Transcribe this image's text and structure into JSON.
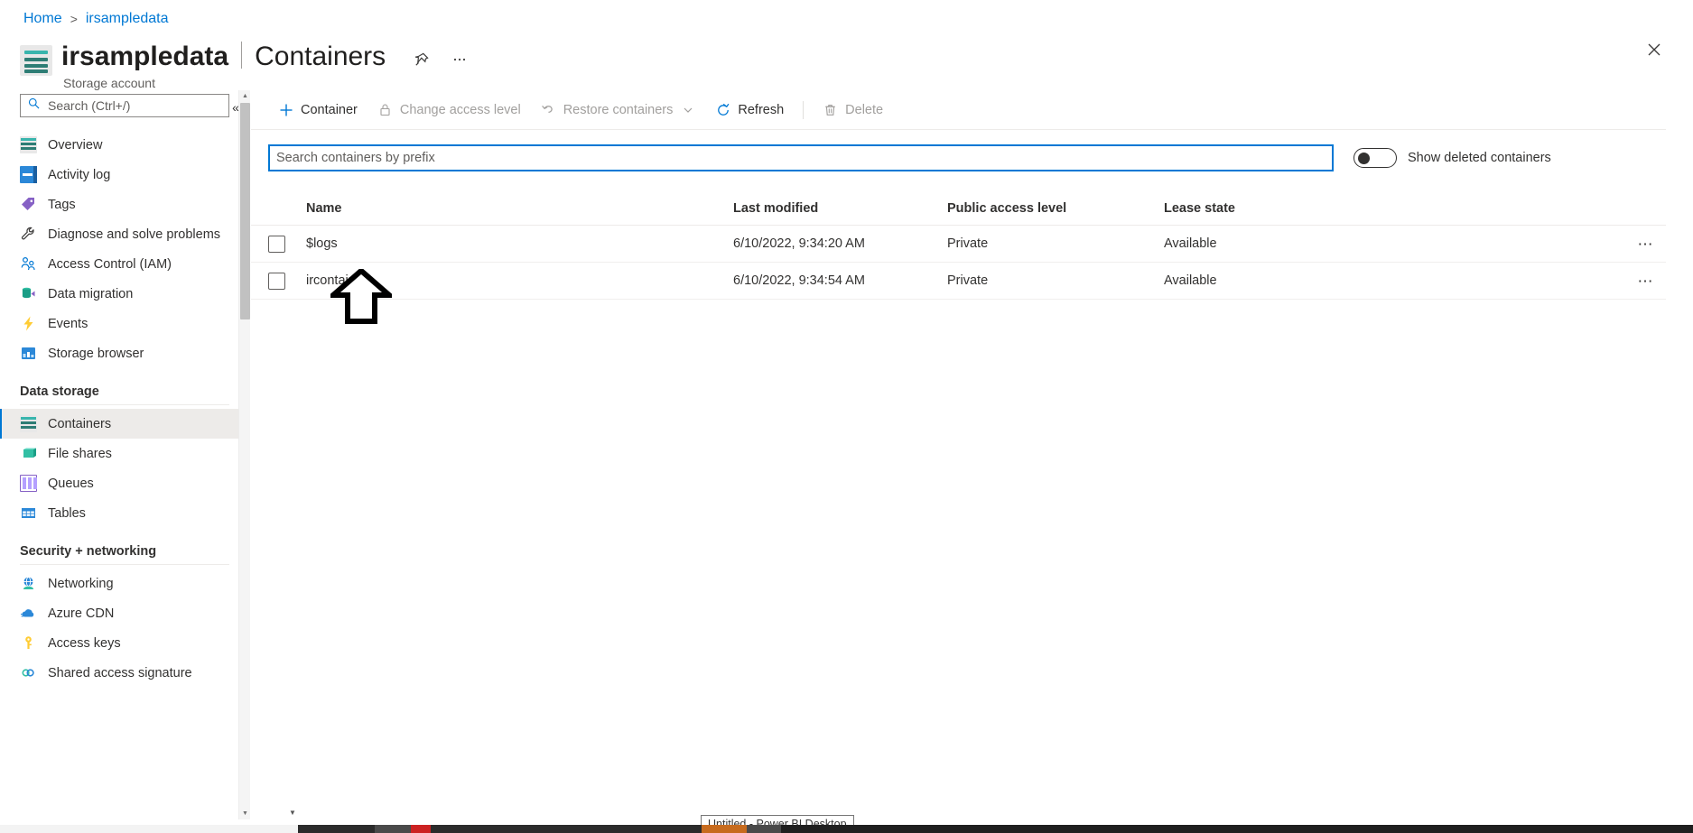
{
  "breadcrumb": {
    "home": "Home",
    "separator": ">",
    "current": "irsampledata"
  },
  "header": {
    "resource_name": "irsampledata",
    "divider": "|",
    "page_name": "Containers",
    "caption": "Storage account",
    "pin_icon": "pin-icon",
    "more_icon": "ellipsis-icon",
    "close_icon": "close-icon",
    "resource_icon": "storage-account-icon"
  },
  "sidebar": {
    "search": {
      "placeholder": "Search (Ctrl+/)",
      "value": "",
      "icon": "search-icon"
    },
    "collapse_icon": "chevron-double-left-icon",
    "items": [
      {
        "label": "Overview",
        "icon": "overview-icon",
        "selected": false
      },
      {
        "label": "Activity log",
        "icon": "activity-log-icon",
        "selected": false
      },
      {
        "label": "Tags",
        "icon": "tags-icon",
        "selected": false
      },
      {
        "label": "Diagnose and solve problems",
        "icon": "wrench-icon",
        "selected": false
      },
      {
        "label": "Access Control (IAM)",
        "icon": "people-icon",
        "selected": false
      },
      {
        "label": "Data migration",
        "icon": "data-migration-icon",
        "selected": false
      },
      {
        "label": "Events",
        "icon": "lightning-icon",
        "selected": false
      },
      {
        "label": "Storage browser",
        "icon": "storage-browser-icon",
        "selected": false
      }
    ],
    "groups": [
      {
        "title": "Data storage",
        "items": [
          {
            "label": "Containers",
            "icon": "containers-icon",
            "selected": true
          },
          {
            "label": "File shares",
            "icon": "file-shares-icon",
            "selected": false
          },
          {
            "label": "Queues",
            "icon": "queues-icon",
            "selected": false
          },
          {
            "label": "Tables",
            "icon": "tables-icon",
            "selected": false
          }
        ]
      },
      {
        "title": "Security + networking",
        "items": [
          {
            "label": "Networking",
            "icon": "networking-icon",
            "selected": false
          },
          {
            "label": "Azure CDN",
            "icon": "cloud-icon",
            "selected": false
          },
          {
            "label": "Access keys",
            "icon": "key-icon",
            "selected": false
          },
          {
            "label": "Shared access signature",
            "icon": "link-icon",
            "selected": false
          }
        ]
      }
    ]
  },
  "toolbar": {
    "container_label": "Container",
    "container_icon": "plus-icon",
    "change_access_label": "Change access level",
    "change_access_icon": "lock-icon",
    "restore_label": "Restore containers",
    "restore_icon": "undo-icon",
    "restore_chevron": "chevron-down-icon",
    "refresh_label": "Refresh",
    "refresh_icon": "refresh-icon",
    "delete_label": "Delete",
    "delete_icon": "trash-icon"
  },
  "filter": {
    "prefix_placeholder": "Search containers by prefix",
    "prefix_value": "",
    "show_deleted_label": "Show deleted containers",
    "show_deleted_on": false
  },
  "table": {
    "columns": [
      "Name",
      "Last modified",
      "Public access level",
      "Lease state"
    ],
    "row_menu_icon": "ellipsis-icon",
    "rows": [
      {
        "name": "$logs",
        "last_modified": "6/10/2022, 9:34:20 AM",
        "public_access_level": "Private",
        "lease_state": "Available",
        "checked": false
      },
      {
        "name": "ircontainer",
        "last_modified": "6/10/2022, 9:34:54 AM",
        "public_access_level": "Private",
        "lease_state": "Available",
        "checked": false
      }
    ]
  },
  "annotation": {
    "arrow_icon": "up-arrow-annotation",
    "points_at": "ircontainer"
  },
  "taskbar": {
    "tooltip_text": "Untitled - Power BI Desktop"
  },
  "colors": {
    "accent": "#0078d4",
    "link": "#0078d4",
    "text": "#323130",
    "muted": "#605e5c",
    "disabled": "#a19f9d",
    "selected_bg": "#edebe9",
    "border": "#edebe9",
    "teal": "#39b5ad"
  }
}
